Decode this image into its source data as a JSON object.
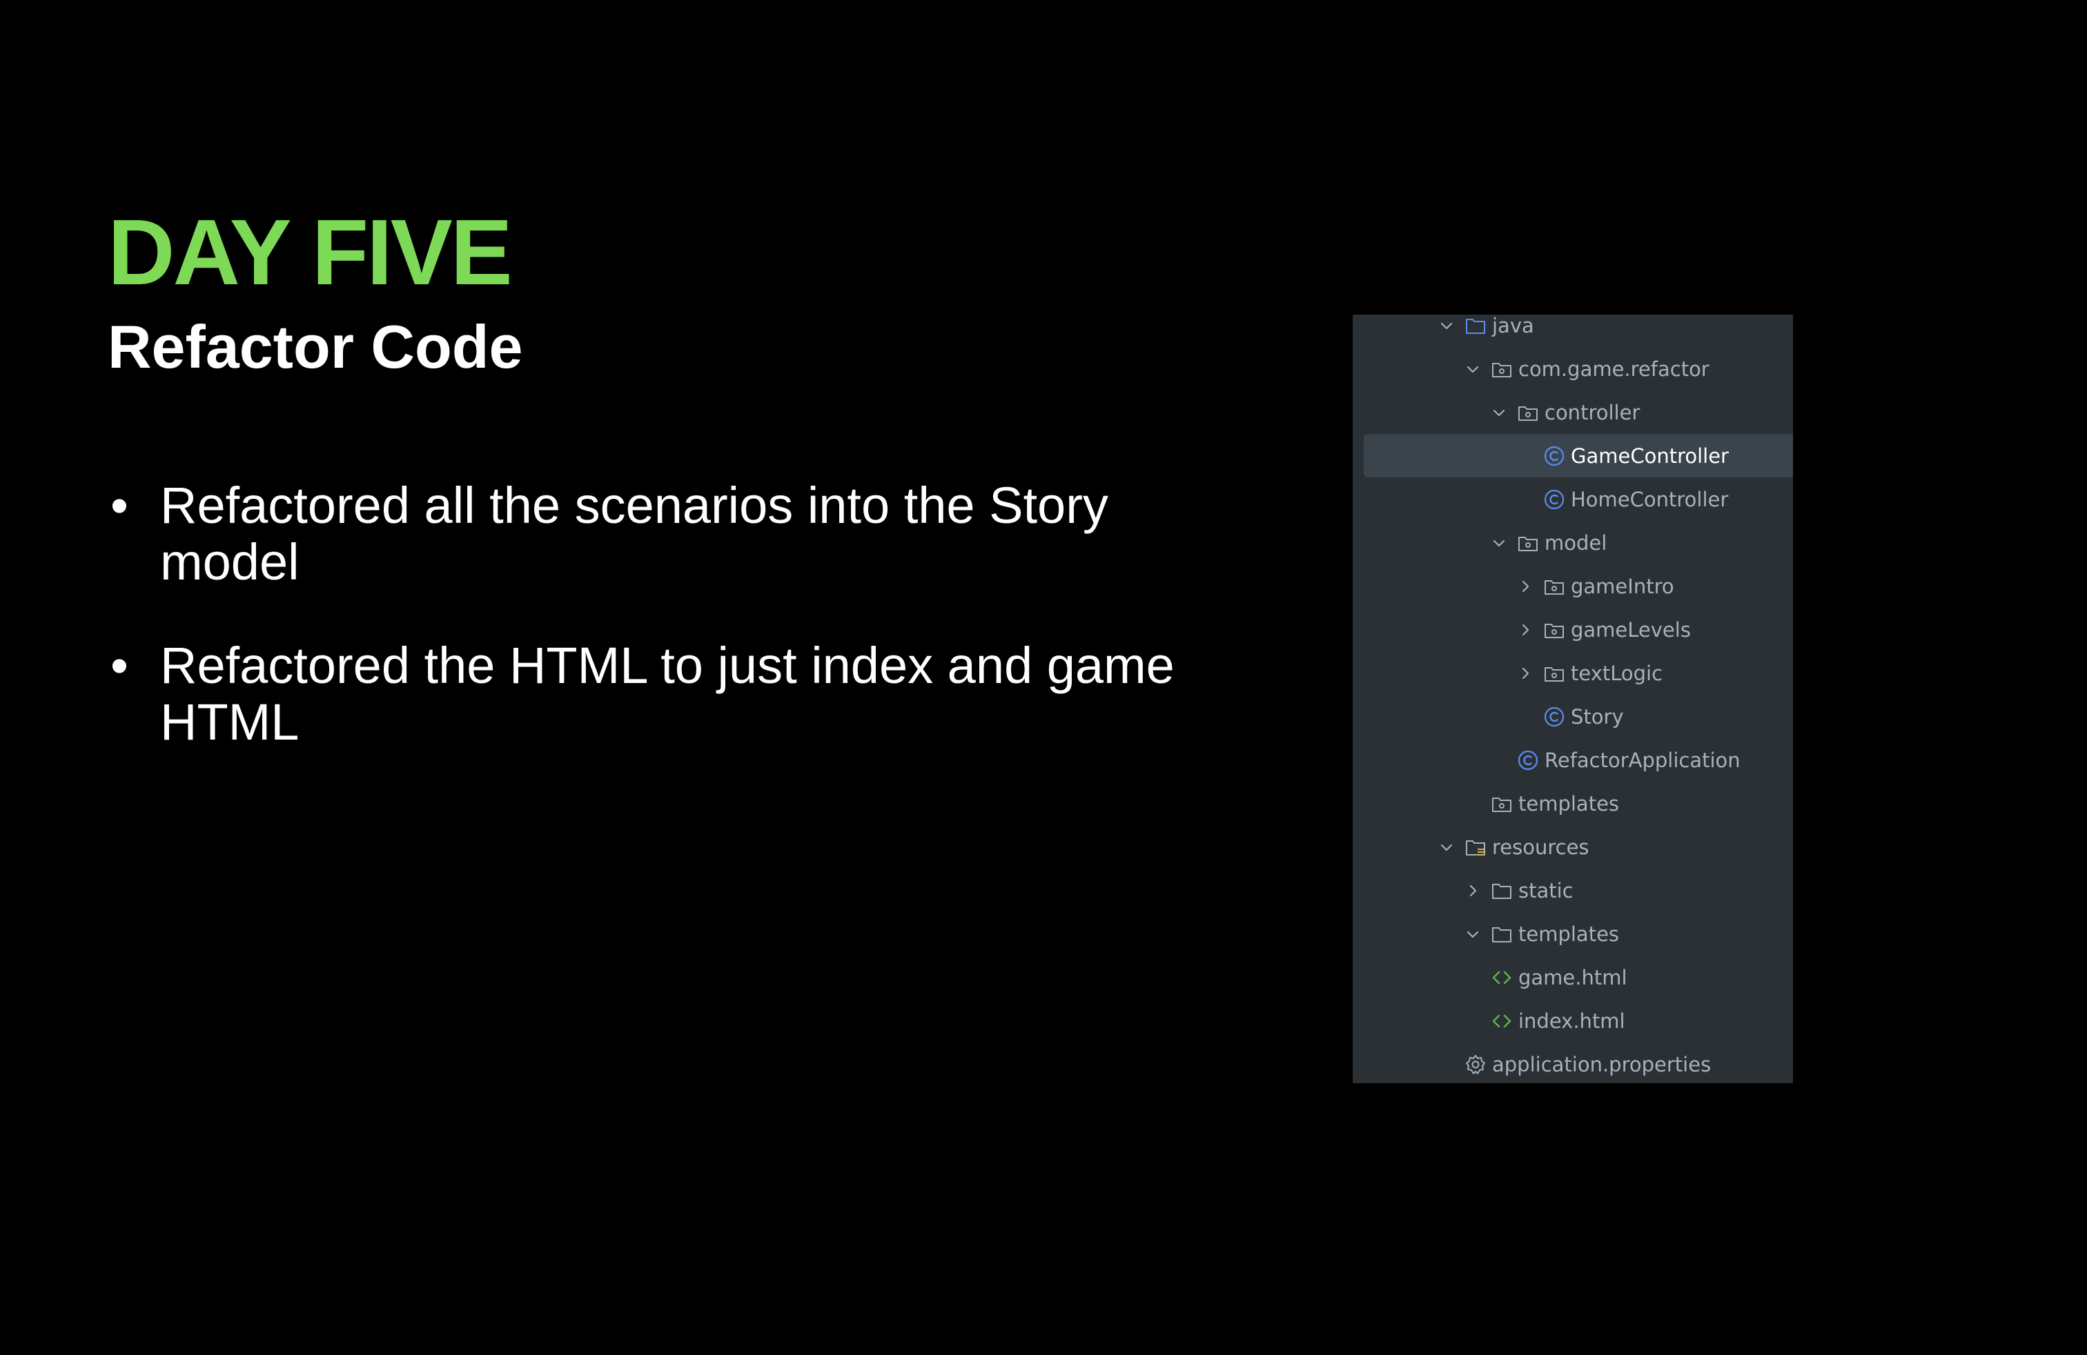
{
  "colors": {
    "background": "#000000",
    "title": "#7ed957",
    "text": "#ffffff",
    "panel_bg": "#2b3035",
    "tree_text": "#a9b1bb",
    "selected_bg": "#3a444d",
    "class_icon": "#5b8cf0",
    "html_icon": "#62b543"
  },
  "slide": {
    "title": "DAY FIVE",
    "subtitle": "Refactor Code",
    "bullets": [
      "Refactored all the scenarios into the Story model",
      "Refactored the HTML to just index and game HTML"
    ]
  },
  "project_tree": {
    "items": [
      {
        "label": "java",
        "icon": "source-folder-icon",
        "expanded": true
      },
      {
        "label": "com.game.refactor",
        "icon": "package-icon",
        "expanded": true
      },
      {
        "label": "controller",
        "icon": "package-icon",
        "expanded": true
      },
      {
        "label": "GameController",
        "icon": "class-icon",
        "selected": true
      },
      {
        "label": "HomeController",
        "icon": "class-icon"
      },
      {
        "label": "model",
        "icon": "package-icon",
        "expanded": true
      },
      {
        "label": "gameIntro",
        "icon": "package-icon",
        "expanded": false
      },
      {
        "label": "gameLevels",
        "icon": "package-icon",
        "expanded": false
      },
      {
        "label": "textLogic",
        "icon": "package-icon",
        "expanded": false
      },
      {
        "label": "Story",
        "icon": "class-icon"
      },
      {
        "label": "RefactorApplication",
        "icon": "class-icon"
      },
      {
        "label": "templates",
        "icon": "package-icon"
      },
      {
        "label": "resources",
        "icon": "resources-folder-icon",
        "expanded": true
      },
      {
        "label": "static",
        "icon": "folder-icon",
        "expanded": false
      },
      {
        "label": "templates",
        "icon": "folder-icon",
        "expanded": true
      },
      {
        "label": "game.html",
        "icon": "html-file-icon"
      },
      {
        "label": "index.html",
        "icon": "html-file-icon"
      },
      {
        "label": "application.properties",
        "icon": "settings-file-icon"
      }
    ]
  }
}
